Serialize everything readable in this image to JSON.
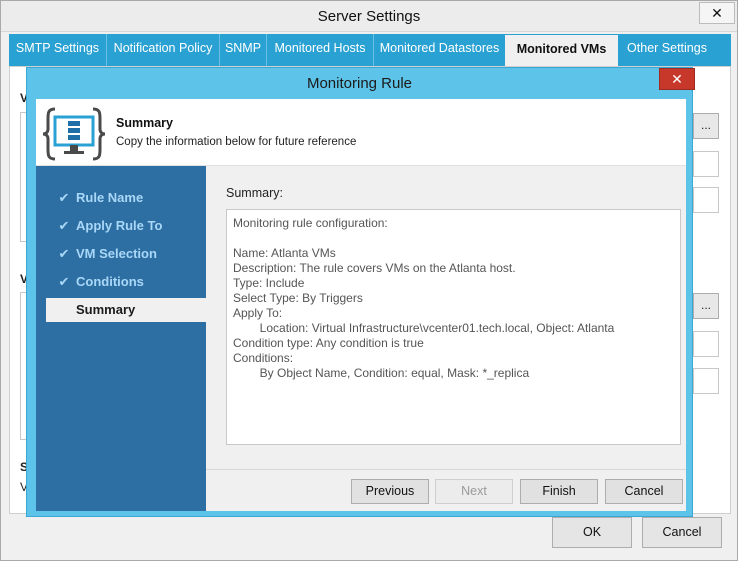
{
  "outer_window": {
    "title": "Server Settings",
    "close_glyph": "✕",
    "tabs": [
      {
        "label": "SMTP Settings",
        "active": false
      },
      {
        "label": "Notification Policy",
        "active": false
      },
      {
        "label": "SNMP",
        "active": false
      },
      {
        "label": "Monitored Hosts",
        "active": false
      },
      {
        "label": "Monitored Datastores",
        "active": false
      },
      {
        "label": "Monitored VMs",
        "active": true
      },
      {
        "label": "Other Settings",
        "active": false
      }
    ],
    "background_glyphs": {
      "section1_letter": "V",
      "section2_letter": "V",
      "section3_letter": "S",
      "section3_sub": "V",
      "browse1": "...",
      "browse2": "..."
    },
    "ok_label": "OK",
    "cancel_label": "Cancel"
  },
  "dialog": {
    "title": "Monitoring Rule",
    "close_glyph": "✕",
    "header": {
      "icon": "monitor-config-icon",
      "title": "Summary",
      "subtitle": "Copy the information below for future reference"
    },
    "steps": [
      {
        "label": "Rule Name",
        "done": true,
        "current": false
      },
      {
        "label": "Apply Rule To",
        "done": true,
        "current": false
      },
      {
        "label": "VM Selection",
        "done": true,
        "current": false
      },
      {
        "label": "Conditions",
        "done": true,
        "current": false
      },
      {
        "label": "Summary",
        "done": false,
        "current": true
      }
    ],
    "check_glyph": "✔",
    "summary_label": "Summary:",
    "summary_text": "Monitoring rule configuration:\n\nName: Atlanta VMs\nDescription: The rule covers VMs on the Atlanta host.\nType: Include\nSelect Type: By Triggers\nApply To:\n        Location: Virtual Infrastructure\\vcenter01.tech.local, Object: Atlanta\nCondition type: Any condition is true\nConditions:\n        By Object Name, Condition: equal, Mask: *_replica",
    "buttons": {
      "previous": "Previous",
      "next": "Next",
      "finish": "Finish",
      "cancel": "Cancel"
    }
  },
  "colors": {
    "tab_bar": "#2aa1d3",
    "dialog_frame": "#5dc3e8",
    "step_panel": "#2e6fa3",
    "close_red": "#c7382b"
  }
}
